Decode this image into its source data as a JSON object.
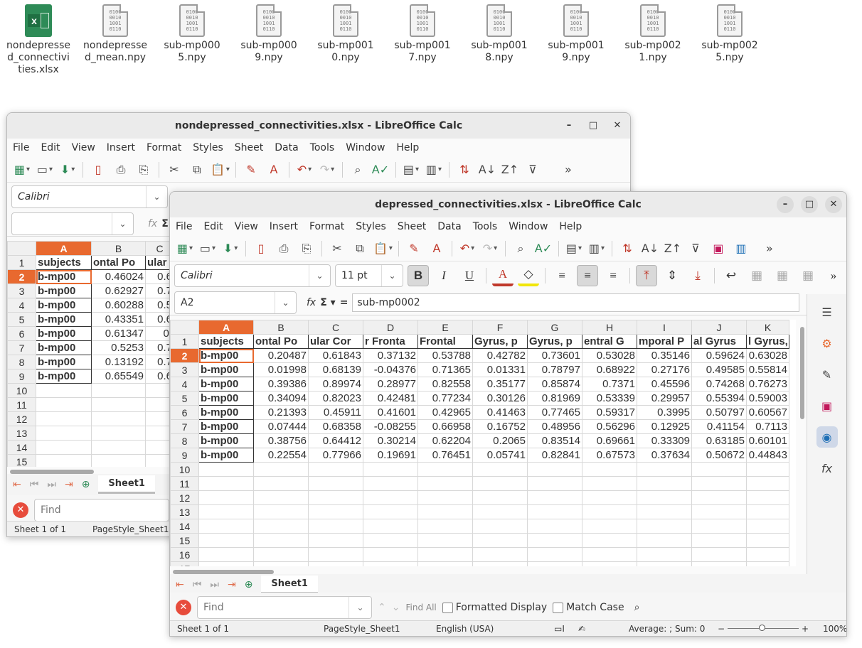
{
  "desktop": {
    "files": [
      {
        "label": "nondepressed_connectivities.xlsx",
        "type": "xlsx"
      },
      {
        "label": "nondepressed_mean.npy",
        "type": "bin"
      },
      {
        "label": "sub-mp0005.npy",
        "type": "bin"
      },
      {
        "label": "sub-mp0009.npy",
        "type": "bin"
      },
      {
        "label": "sub-mp0010.npy",
        "type": "bin"
      },
      {
        "label": "sub-mp0017.npy",
        "type": "bin"
      },
      {
        "label": "sub-mp0018.npy",
        "type": "bin"
      },
      {
        "label": "sub-mp0019.npy",
        "type": "bin"
      },
      {
        "label": "sub-mp0021.npy",
        "type": "bin"
      },
      {
        "label": "sub-mp0025.npy",
        "type": "bin"
      }
    ],
    "binary_glyph": "0100\n0010\n1001\n0110"
  },
  "menu": [
    "File",
    "Edit",
    "View",
    "Insert",
    "Format",
    "Styles",
    "Sheet",
    "Data",
    "Tools",
    "Window",
    "Help"
  ],
  "back_window": {
    "title": "nondepressed_connectivities.xlsx - LibreOffice Calc",
    "font_name": "Calibri",
    "name_box": "",
    "col_headers": [
      "A",
      "B",
      "C"
    ],
    "row_numbers": [
      "1",
      "2",
      "3",
      "4",
      "5",
      "6",
      "7",
      "8",
      "9",
      "10",
      "11",
      "12",
      "13",
      "14",
      "15"
    ],
    "header_row": [
      "subjects",
      "ontal Po",
      "ular"
    ],
    "rows": [
      [
        "b-mp00",
        "0.46024",
        "0.6"
      ],
      [
        "b-mp00",
        "0.62927",
        "0.7"
      ],
      [
        "b-mp00",
        "0.60288",
        "0.5"
      ],
      [
        "b-mp00",
        "0.43351",
        "0.6"
      ],
      [
        "b-mp00",
        "0.61347",
        "0."
      ],
      [
        "b-mp00",
        "0.5253",
        "0.7"
      ],
      [
        "b-mp00",
        "0.13192",
        "0.7"
      ],
      [
        "b-mp00",
        "0.65549",
        "0.6"
      ]
    ],
    "sheet_tab": "Sheet1",
    "find_placeholder": "Find",
    "status_sheet": "Sheet 1 of 1",
    "status_pagestyle": "PageStyle_Sheet1"
  },
  "front_window": {
    "title": "depressed_connectivities.xlsx - LibreOffice Calc",
    "font_name": "Calibri",
    "font_size": "11 pt",
    "name_box": "A2",
    "formula_value": "sub-mp0002",
    "col_headers": [
      "A",
      "B",
      "C",
      "D",
      "E",
      "F",
      "G",
      "H",
      "I",
      "J",
      "K"
    ],
    "row_numbers": [
      "1",
      "2",
      "3",
      "4",
      "5",
      "6",
      "7",
      "8",
      "9",
      "10",
      "11",
      "12",
      "13",
      "14",
      "15",
      "16",
      "17"
    ],
    "header_row": [
      "subjects",
      "ontal Po",
      "ular Cor",
      "r Fronta",
      "Frontal",
      "Gyrus, p",
      "Gyrus, p",
      "entral G",
      "mporal P",
      "al Gyrus",
      "l Gyrus,"
    ],
    "rows": [
      [
        "b-mp00",
        "0.20487",
        "0.61843",
        "0.37132",
        "0.53788",
        "0.42782",
        "0.73601",
        "0.53028",
        "0.35146",
        "0.59624",
        "0.63028"
      ],
      [
        "b-mp00",
        "0.01998",
        "0.68139",
        "-0.04376",
        "0.71365",
        "0.01331",
        "0.78797",
        "0.68922",
        "0.27176",
        "0.49585",
        "0.55814"
      ],
      [
        "b-mp00",
        "0.39386",
        "0.89974",
        "0.28977",
        "0.82558",
        "0.35177",
        "0.85874",
        "0.7371",
        "0.45596",
        "0.74268",
        "0.76273"
      ],
      [
        "b-mp00",
        "0.34094",
        "0.82023",
        "0.42481",
        "0.77234",
        "0.30126",
        "0.81969",
        "0.53339",
        "0.29957",
        "0.55394",
        "0.59003"
      ],
      [
        "b-mp00",
        "0.21393",
        "0.45911",
        "0.41601",
        "0.42965",
        "0.41463",
        "0.77465",
        "0.59317",
        "0.3995",
        "0.50797",
        "0.60567"
      ],
      [
        "b-mp00",
        "0.07444",
        "0.68358",
        "-0.08255",
        "0.66958",
        "0.16752",
        "0.48956",
        "0.56296",
        "0.12925",
        "0.41154",
        "0.7113"
      ],
      [
        "b-mp00",
        "0.38756",
        "0.64412",
        "0.30214",
        "0.62204",
        "0.2065",
        "0.83514",
        "0.69661",
        "0.33309",
        "0.63185",
        "0.60101"
      ],
      [
        "b-mp00",
        "0.22554",
        "0.77966",
        "0.19691",
        "0.76451",
        "0.05741",
        "0.82841",
        "0.67573",
        "0.37634",
        "0.50672",
        "0.44843"
      ]
    ],
    "sheet_tab": "Sheet1",
    "find_placeholder": "Find",
    "find_all": "Find All",
    "formatted_display": "Formatted Display",
    "match_case": "Match Case",
    "status_sheet": "Sheet 1 of 1",
    "status_pagestyle": "PageStyle_Sheet1",
    "status_language": "English (USA)",
    "status_summary": "Average: ; Sum: 0",
    "zoom": "100%"
  },
  "colors": {
    "accent": "#e8692f",
    "find_close": "#e74c3c"
  }
}
